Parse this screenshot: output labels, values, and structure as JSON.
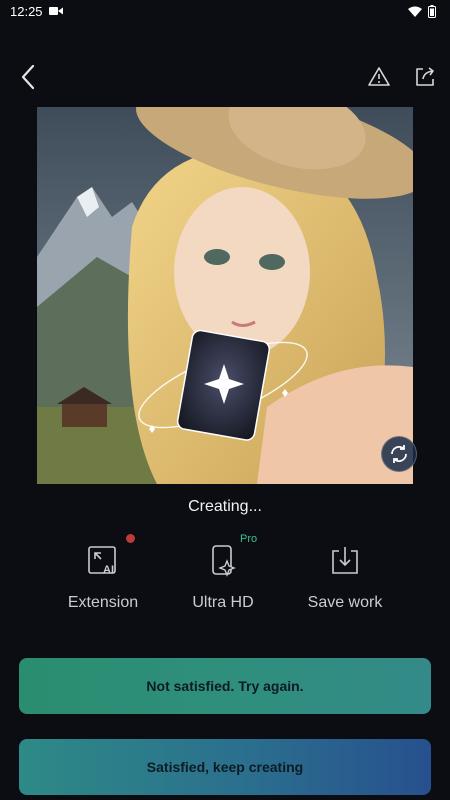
{
  "status_bar": {
    "time": "12:25"
  },
  "icons": {
    "video": "video-camera-icon",
    "wifi": "wifi-icon",
    "battery": "battery-icon",
    "back": "chevron-left-icon",
    "report": "warning-triangle-icon",
    "share": "share-icon",
    "refresh": "refresh-icon",
    "sparkle": "sparkle-icon"
  },
  "main": {
    "status_text": "Creating..."
  },
  "tools": [
    {
      "label": "Extension",
      "icon": "ai-expand-icon",
      "has_dot": true
    },
    {
      "label": "Ultra HD",
      "icon": "phone-sparkle-icon",
      "badge": "Pro"
    },
    {
      "label": "Save work",
      "icon": "download-icon"
    }
  ],
  "buttons": {
    "retry": "Not satisfied. Try again.",
    "keep": "Satisfied, keep creating"
  },
  "colors": {
    "background": "#0c0d12",
    "pro_badge": "#39c08a",
    "notification_dot": "#c0393b",
    "retry_button": "#2a8d6f",
    "keep_button": "#27508e"
  }
}
